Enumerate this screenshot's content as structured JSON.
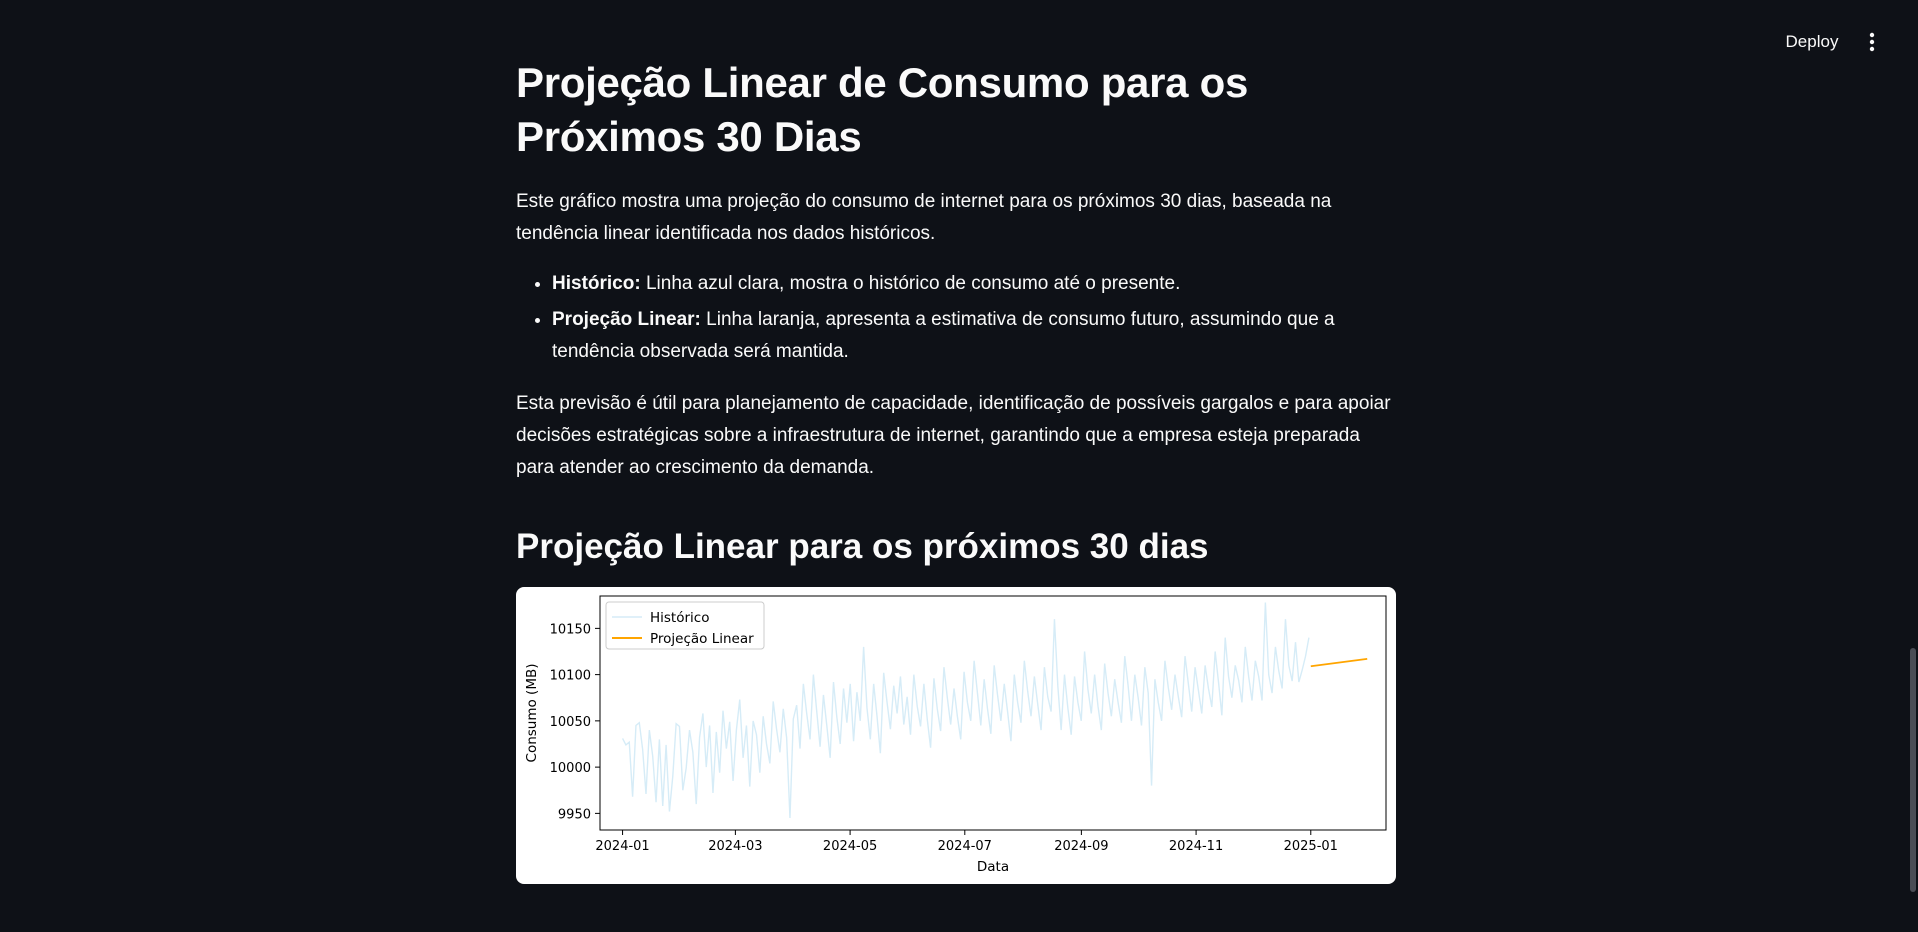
{
  "header": {
    "deploy_label": "Deploy",
    "menu_icon": "vertical-ellipsis-icon"
  },
  "page": {
    "title": "Projeção Linear de Consumo para os Próximos 30 Dias",
    "intro": "Este gráfico mostra uma projeção do consumo de internet para os próximos 30 dias, baseada na tendência linear identificada nos dados históricos.",
    "bullets": [
      {
        "bold": "Histórico:",
        "text": " Linha azul clara, mostra o histórico de consumo até o presente."
      },
      {
        "bold": "Projeção Linear:",
        "text": " Linha laranja, apresenta a estimativa de consumo futuro, assumindo que a tendência observada será mantida."
      }
    ],
    "outro": "Esta previsão é útil para planejamento de capacidade, identificação de possíveis gargalos e para apoiar decisões estratégicas sobre a infraestrutura de internet, garantindo que a empresa esteja preparada para atender ao crescimento da demanda.",
    "subtitle": "Projeção Linear para os próximos 30 dias"
  },
  "chart_data": {
    "type": "line",
    "title": "",
    "xlabel": "Data",
    "ylabel": "Consumo (MB)",
    "x_ticks": [
      "2024-01",
      "2024-03",
      "2024-05",
      "2024-07",
      "2024-09",
      "2024-11",
      "2025-01"
    ],
    "y_ticks": [
      9950,
      10000,
      10050,
      10100,
      10150
    ],
    "xlim": [
      "2023-12-20",
      "2025-02-10"
    ],
    "ylim": [
      9932,
      10185
    ],
    "grid": false,
    "legend_position": "top-left",
    "series": [
      {
        "name": "Histórico",
        "color": "#d6ecf7",
        "x_start": "2024-01-01",
        "x_end": "2024-12-31",
        "trend_start": 10005,
        "trend_end": 10110,
        "values": [
          10031,
          10024,
          10027,
          9968,
          10045,
          10048,
          10019,
          9971,
          10040,
          10012,
          9962,
          10030,
          9958,
          10024,
          9952,
          9990,
          10047,
          10044,
          9975,
          9999,
          10040,
          10016,
          9960,
          10032,
          10058,
          10000,
          10045,
          9972,
          10038,
          9994,
          10061,
          10020,
          10049,
          9985,
          10040,
          10073,
          10010,
          10045,
          9979,
          10050,
          10035,
          9994,
          10055,
          10025,
          10004,
          10071,
          10041,
          10016,
          10063,
          10032,
          9945,
          10052,
          10067,
          10020,
          10090,
          10058,
          10030,
          10100,
          10060,
          10022,
          10078,
          10045,
          10010,
          10092,
          10054,
          10025,
          10085,
          10048,
          10090,
          10028,
          10081,
          10050,
          10130,
          10064,
          10030,
          10090,
          10055,
          10015,
          10102,
          10070,
          10041,
          10088,
          10058,
          10098,
          10046,
          10076,
          10035,
          10100,
          10066,
          10044,
          10090,
          10052,
          10021,
          10096,
          10063,
          10039,
          10108,
          10075,
          10046,
          10085,
          10055,
          10030,
          10103,
          10070,
          10050,
          10115,
          10080,
          10045,
          10095,
          10063,
          10036,
          10110,
          10078,
          10050,
          10090,
          10060,
          10028,
          10100,
          10070,
          10048,
          10115,
          10082,
          10055,
          10098,
          10068,
          10040,
          10108,
          10076,
          10060,
          10160,
          10088,
          10040,
          10100,
          10064,
          10035,
          10098,
          10070,
          10050,
          10125,
          10084,
          10058,
          10100,
          10066,
          10040,
          10112,
          10080,
          10055,
          10095,
          10070,
          10048,
          10120,
          10088,
          10050,
          10100,
          10075,
          10045,
          10108,
          10080,
          9980,
          10095,
          10070,
          10050,
          10115,
          10086,
          10062,
          10100,
          10076,
          10054,
          10120,
          10090,
          10060,
          10108,
          10083,
          10058,
          10110,
          10085,
          10065,
          10125,
          10092,
          10056,
          10140,
          10098,
          10075,
          10110,
          10094,
          10070,
          10130,
          10098,
          10072,
          10115,
          10098,
          10072,
          10178,
          10100,
          10080,
          10130,
          10104,
          10085,
          10160,
          10110,
          10093,
          10135,
          10092,
          10105,
          10120,
          10140
        ]
      },
      {
        "name": "Projeção Linear",
        "color": "#ffa500",
        "x_start": "2025-01-01",
        "x_end": "2025-01-31",
        "y_start": 10109,
        "y_end": 10117
      }
    ]
  }
}
